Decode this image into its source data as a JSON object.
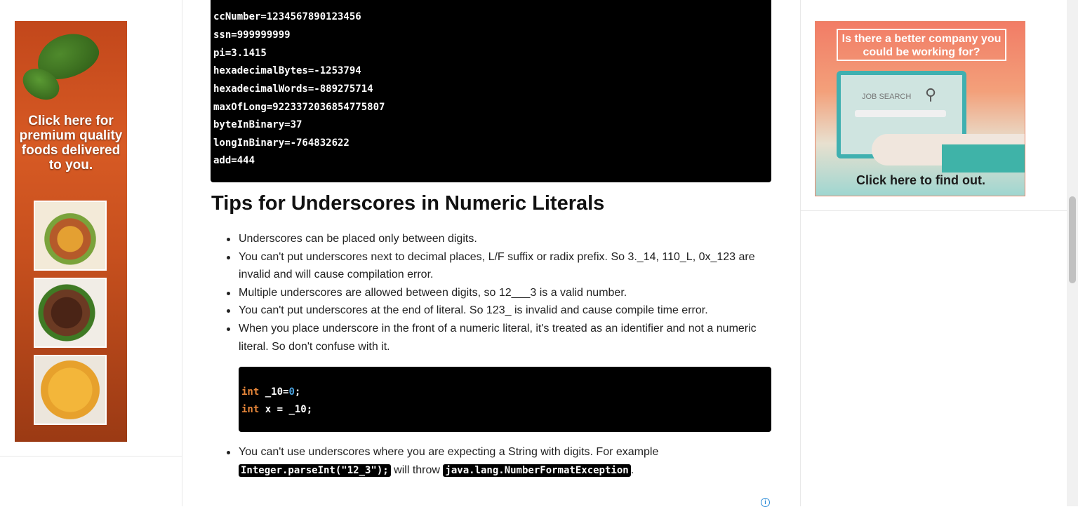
{
  "top_code": {
    "lines": [
      "ccNumber=1234567890123456",
      "ssn=999999999",
      "pi=3.1415",
      "hexadecimalBytes=-1253794",
      "hexadecimalWords=-889275714",
      "maxOfLong=9223372036854775807",
      "byteInBinary=37",
      "longInBinary=-764832622",
      "add=444"
    ]
  },
  "article": {
    "heading": "Tips for Underscores in Numeric Literals",
    "bullets": [
      "Underscores can be placed only between digits.",
      "You can't put underscores next to decimal places, L/F suffix or radix prefix. So 3._14, 110_L, 0x_123 are invalid and will cause compilation error.",
      "Multiple underscores are allowed between digits, so 12___3 is a valid number.",
      "You can't put underscores at the end of literal. So 123_ is invalid and cause compile time error.",
      "When you place underscore in the front of a numeric literal, it's treated as an identifier and not a numeric literal. So don't confuse with it."
    ],
    "code_example": {
      "line1": {
        "kw": "int",
        "name": " _10=",
        "num": "0",
        "end": ";"
      },
      "line2": {
        "kw": "int",
        "rest": " x = _10;"
      }
    },
    "last_bullet": {
      "text_before": "You can't use underscores where you are expecting a String with digits. For example",
      "code1": "Integer.parseInt(\"12_3\");",
      "middle": " will throw ",
      "code2": "java.lang.NumberFormatException",
      "end": "."
    }
  },
  "ads": {
    "left": {
      "text": "Click here for premium quality foods delivered to you."
    },
    "right": {
      "headline": "Is there a better company you could be working for?",
      "search_label": "JOB SEARCH",
      "cta": "Click here to find out."
    },
    "info_icon": "info-icon"
  }
}
